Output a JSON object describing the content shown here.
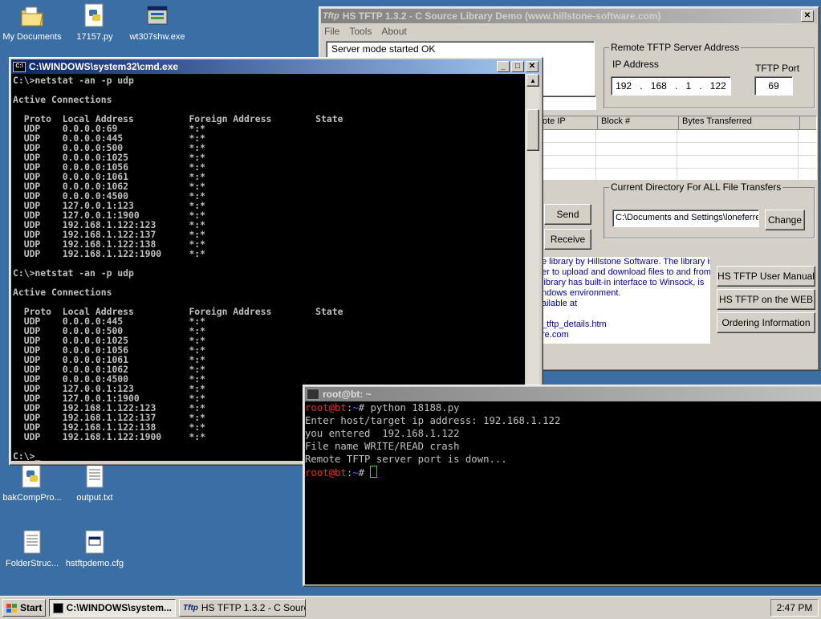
{
  "desktop": {
    "icons": [
      {
        "label": "My Documents"
      },
      {
        "label": "17157.py"
      },
      {
        "label": "wt307shw.exe"
      },
      {
        "label": "bakCompPro..."
      },
      {
        "label": "output.txt"
      },
      {
        "label": "FolderStruc..."
      },
      {
        "label": "hstftpdemo.cfg"
      }
    ]
  },
  "tftp": {
    "title": "HS TFTP 1.3.2 - C Source Library Demo  (www.hillstone-software.com)",
    "title_icon": "Tftp",
    "menu": [
      "File",
      "Tools",
      "About"
    ],
    "status": "Server mode started OK",
    "remote_group": "Remote TFTP Server Address",
    "ip_label": "IP Address",
    "ip": [
      "192",
      "168",
      "1",
      "122"
    ],
    "port_label": "TFTP Port",
    "port": "69",
    "columns": [
      "ote IP",
      "Block #",
      "Bytes Transferred"
    ],
    "send": "Send",
    "receive": "Receive",
    "dir_group": "Current Directory For ALL File Transfers",
    "dir": "C:\\Documents and Settings\\loneferre",
    "change": "Change",
    "info": [
      "e library by Hillstone Software. The library is",
      "er to upload and download files to and from",
      "library has built-in interface to Winsock, is",
      "ndows environment.",
      "ailable at",
      "",
      "_tftp_details.htm",
      "re.com"
    ],
    "manual": "HS TFTP User Manual",
    "web": "HS TFTP on the WEB",
    "order": "Ordering Information"
  },
  "cmd": {
    "title": "C:\\WINDOWS\\system32\\cmd.exe",
    "text": "C:\\>netstat -an -p udp\n\nActive Connections\n\n  Proto  Local Address          Foreign Address        State\n  UDP    0.0.0.0:69             *:*\n  UDP    0.0.0.0:445            *:*\n  UDP    0.0.0.0:500            *:*\n  UDP    0.0.0.0:1025           *:*\n  UDP    0.0.0.0:1056           *:*\n  UDP    0.0.0.0:1061           *:*\n  UDP    0.0.0.0:1062           *:*\n  UDP    0.0.0.0:4500           *:*\n  UDP    127.0.0.1:123          *:*\n  UDP    127.0.0.1:1900         *:*\n  UDP    192.168.1.122:123      *:*\n  UDP    192.168.1.122:137      *:*\n  UDP    192.168.1.122:138      *:*\n  UDP    192.168.1.122:1900     *:*\n\nC:\\>netstat -an -p udp\n\nActive Connections\n\n  Proto  Local Address          Foreign Address        State\n  UDP    0.0.0.0:445            *:*\n  UDP    0.0.0.0:500            *:*\n  UDP    0.0.0.0:1025           *:*\n  UDP    0.0.0.0:1056           *:*\n  UDP    0.0.0.0:1061           *:*\n  UDP    0.0.0.0:1062           *:*\n  UDP    0.0.0.0:4500           *:*\n  UDP    127.0.0.1:123          *:*\n  UDP    127.0.0.1:1900         *:*\n  UDP    192.168.1.122:123      *:*\n  UDP    192.168.1.122:137      *:*\n  UDP    192.168.1.122:138      *:*\n  UDP    192.168.1.122:1900     *:*\n\nC:\\>_"
  },
  "terminal": {
    "title": "root@bt: ~",
    "prompt_user": "root@bt",
    "prompt_sep": ":",
    "prompt_path": "~",
    "prompt_end": "# ",
    "cmd1": "python 18188.py",
    "out1": "Enter host/target ip address: 192.168.1.122",
    "out2": "you entered  192.168.1.122",
    "out3": "File name WRITE/READ crash",
    "out4": "Remote TFTP server port is down..."
  },
  "taskbar": {
    "start": "Start",
    "items": [
      "C:\\WINDOWS\\system...",
      "HS TFTP 1.3.2 - C Sourc..."
    ],
    "clock": "2:47 PM"
  }
}
